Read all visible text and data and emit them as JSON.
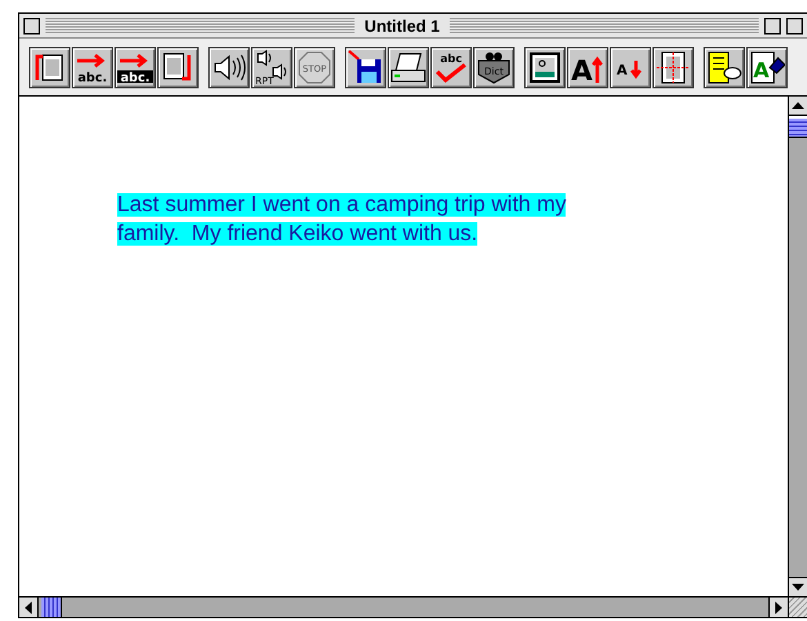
{
  "window": {
    "title": "Untitled 1"
  },
  "toolbar": {
    "groups": [
      [
        {
          "kind": "page-up",
          "disabled": false
        },
        {
          "kind": "arrow-abc",
          "label": "abc.",
          "disabled": false
        },
        {
          "kind": "arrow-abc-inverse",
          "label": "abc.",
          "disabled": false
        },
        {
          "kind": "page-down",
          "disabled": false
        }
      ],
      [
        {
          "kind": "speaker",
          "disabled": false
        },
        {
          "kind": "repeat",
          "label": "RPT",
          "disabled": false
        },
        {
          "kind": "stop",
          "label": "STOP",
          "disabled": true
        }
      ],
      [
        {
          "kind": "save",
          "disabled": false
        },
        {
          "kind": "printer",
          "disabled": false
        },
        {
          "kind": "spell",
          "label": "abc",
          "disabled": false
        },
        {
          "kind": "dict",
          "label": "Dict",
          "disabled": false
        }
      ],
      [
        {
          "kind": "picture",
          "disabled": false
        },
        {
          "kind": "font-up",
          "label": "A",
          "disabled": false
        },
        {
          "kind": "font-down",
          "label": "A",
          "disabled": false
        },
        {
          "kind": "margins",
          "disabled": false
        }
      ],
      [
        {
          "kind": "highlight",
          "disabled": false
        },
        {
          "kind": "color-letter",
          "label": "A",
          "disabled": false
        }
      ]
    ]
  },
  "document": {
    "selected": true,
    "lines": [
      "Last summer I went on a camping trip with my",
      "family.  My friend Keiko went with us."
    ]
  }
}
